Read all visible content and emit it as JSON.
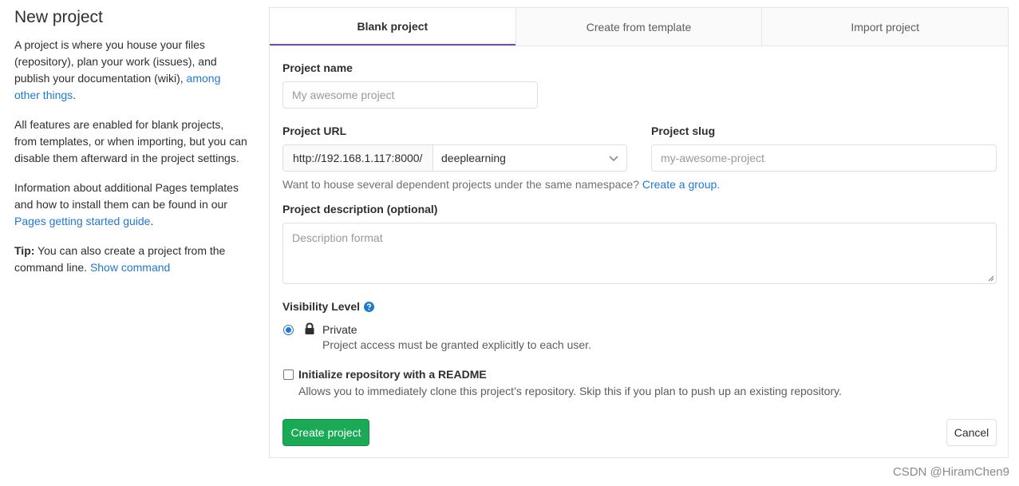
{
  "sidebar": {
    "title": "New project",
    "p1_text": "A project is where you house your files (repository), plan your work (issues), and publish your documentation (wiki),",
    "p1_link": "among other things",
    "p1_end": ".",
    "p2_text": "All features are enabled for blank projects, from templates, or when importing, but you can disable them afterward in the project settings.",
    "p3_text": "Information about additional Pages templates and how to install them can be found in our",
    "p3_link": "Pages getting started guide",
    "p3_end": ".",
    "tip_label": "Tip:",
    "tip_text": "You can also create a project from the command line.",
    "tip_link": "Show command"
  },
  "tabs": [
    {
      "label": "Blank project"
    },
    {
      "label": "Create from template"
    },
    {
      "label": "Import project"
    }
  ],
  "form": {
    "project_name_label": "Project name",
    "project_name_placeholder": "My awesome project",
    "project_url_label": "Project URL",
    "url_prefix": "http://192.168.1.117:8000/",
    "namespace_value": "deeplearning",
    "project_slug_label": "Project slug",
    "project_slug_placeholder": "my-awesome-project",
    "namespace_help": "Want to house several dependent projects under the same namespace?",
    "namespace_help_link": "Create a group.",
    "description_label": "Project description (optional)",
    "description_placeholder": "Description format",
    "visibility_label": "Visibility Level",
    "visibility_option_label": "Private",
    "visibility_option_help": "Project access must be granted explicitly to each user.",
    "readme_label": "Initialize repository with a README",
    "readme_help": "Allows you to immediately clone this project’s repository. Skip this if you plan to push up an existing repository.",
    "create_button": "Create project",
    "cancel_button": "Cancel"
  },
  "icons": {
    "help": "question-circle-icon",
    "lock": "lock-icon",
    "dropdown": "chevron-down-icon"
  },
  "colors": {
    "accent": "#1f78d1",
    "success": "#1aaa55",
    "tab_active_border": "#6b4fbb"
  },
  "watermark": "CSDN @HiramChen9"
}
